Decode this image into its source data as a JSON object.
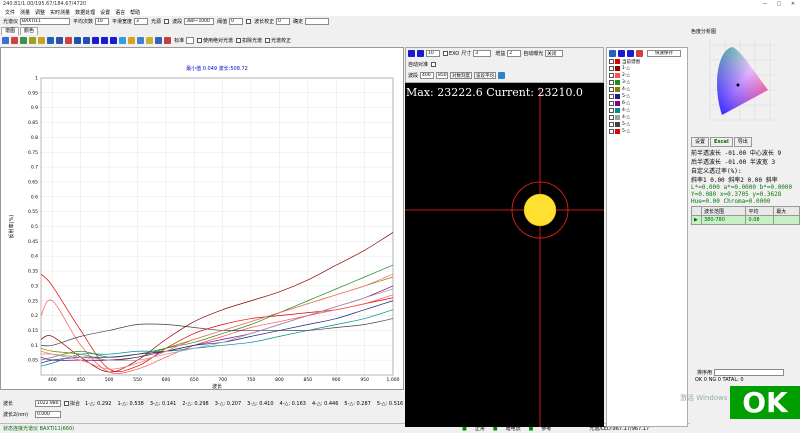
{
  "window": {
    "title": "240.81/1.00/195.67/184.67/4720",
    "controls": [
      "—",
      "□",
      "✕"
    ]
  },
  "menu": [
    "文件",
    "测量",
    "调整",
    "实时测量",
    "数据处理",
    "设置",
    "语言",
    "帮助"
  ],
  "toolbar1": {
    "spectrometer_label": "光谱仪",
    "spectrometer_value": "BAXTI11",
    "avg_label": "平均次数",
    "avg_value": "10",
    "smooth_label": "平滑宽度",
    "smooth_value": "3",
    "source_label": "光源",
    "fit_label": "波段",
    "fit_value": "380~1000",
    "threshold_label": "阈值",
    "threshold_value": "0",
    "wl_corr_label": "波长校正",
    "wl_corr_value": "0",
    "label_last": "确定"
  },
  "tabs_left": [
    "谱图",
    "颜色"
  ],
  "toolbar2": {
    "standard_label": "标准",
    "check1": "使用绝对光谱",
    "check2": "扣除光谱",
    "check3": "光谱校正"
  },
  "chart_data": {
    "type": "line",
    "title": "最小值 0.049 波长:508.72",
    "xlabel": "波长",
    "ylabel": "反射率(%)",
    "xlim": [
      380,
      1000
    ],
    "ylim": [
      0,
      1
    ],
    "x_ticks": [
      400,
      450,
      500,
      550,
      600,
      650,
      700,
      750,
      800,
      850,
      900,
      950,
      "1,000"
    ],
    "y_ticks": [
      "0.05",
      "0.1",
      "0.15",
      "0.2",
      "0.25",
      "0.3",
      "0.35",
      "0.4",
      "0.45",
      "0.5",
      "0.55",
      "0.6",
      "0.65",
      "0.7",
      "0.75",
      "0.8",
      "0.85",
      "0.9",
      "0.95",
      "1"
    ],
    "grid": true,
    "series": [
      {
        "color": "#8b0000",
        "x": [
          380,
          400,
          450,
          500,
          550,
          600,
          650,
          700,
          750,
          800,
          850,
          900,
          950,
          1000
        ],
        "y": [
          0.12,
          0.13,
          0.06,
          0.01,
          0.05,
          0.12,
          0.18,
          0.22,
          0.25,
          0.28,
          0.32,
          0.37,
          0.42,
          0.48
        ]
      },
      {
        "color": "#e00000",
        "x": [
          380,
          400,
          450,
          500,
          550,
          600,
          650,
          700,
          750,
          800,
          850,
          900,
          950,
          1000
        ],
        "y": [
          0.34,
          0.3,
          0.15,
          0.02,
          0.03,
          0.09,
          0.14,
          0.17,
          0.19,
          0.2,
          0.21,
          0.22,
          0.24,
          0.26
        ]
      },
      {
        "color": "#ff5050",
        "x": [
          380,
          400,
          450,
          500,
          550,
          600,
          650,
          700,
          750,
          800,
          850,
          900,
          950,
          1000
        ],
        "y": [
          0.2,
          0.25,
          0.1,
          0.01,
          0.02,
          0.06,
          0.1,
          0.13,
          0.16,
          0.18,
          0.2,
          0.22,
          0.24,
          0.27
        ]
      },
      {
        "color": "#228b22",
        "x": [
          380,
          400,
          450,
          500,
          550,
          600,
          650,
          700,
          750,
          800,
          850,
          900,
          950,
          1000
        ],
        "y": [
          0.05,
          0.06,
          0.08,
          0.06,
          0.07,
          0.09,
          0.11,
          0.14,
          0.17,
          0.21,
          0.25,
          0.29,
          0.33,
          0.37
        ]
      },
      {
        "color": "#808000",
        "x": [
          380,
          400,
          450,
          500,
          550,
          600,
          650,
          700,
          750,
          800,
          850,
          900,
          950,
          1000
        ],
        "y": [
          0.09,
          0.08,
          0.07,
          0.05,
          0.06,
          0.09,
          0.12,
          0.15,
          0.18,
          0.21,
          0.24,
          0.27,
          0.3,
          0.33
        ]
      },
      {
        "color": "#800080",
        "x": [
          380,
          400,
          450,
          500,
          550,
          600,
          650,
          700,
          750,
          800,
          850,
          900,
          950,
          1000
        ],
        "y": [
          0.06,
          0.05,
          0.05,
          0.05,
          0.06,
          0.08,
          0.1,
          0.12,
          0.14,
          0.17,
          0.2,
          0.23,
          0.26,
          0.3
        ]
      },
      {
        "color": "#1c1c8c",
        "x": [
          380,
          400,
          450,
          500,
          550,
          600,
          650,
          700,
          750,
          800,
          850,
          900,
          950,
          1000
        ],
        "y": [
          0.04,
          0.05,
          0.06,
          0.06,
          0.07,
          0.08,
          0.1,
          0.11,
          0.13,
          0.15,
          0.17,
          0.19,
          0.22,
          0.25
        ]
      },
      {
        "color": "#008b8b",
        "x": [
          380,
          400,
          450,
          500,
          550,
          600,
          650,
          700,
          750,
          800,
          850,
          900,
          950,
          1000
        ],
        "y": [
          0.03,
          0.04,
          0.07,
          0.07,
          0.08,
          0.08,
          0.09,
          0.1,
          0.11,
          0.13,
          0.15,
          0.17,
          0.19,
          0.22
        ]
      },
      {
        "color": "#404040",
        "x": [
          380,
          400,
          450,
          500,
          550,
          600,
          650,
          700,
          750,
          800,
          850,
          900,
          950,
          1000
        ],
        "y": [
          0.1,
          0.1,
          0.13,
          0.15,
          0.17,
          0.17,
          0.16,
          0.15,
          0.15,
          0.15,
          0.15,
          0.16,
          0.17,
          0.19
        ]
      },
      {
        "color": "#a0a0a0",
        "x": [
          380,
          400,
          450,
          500,
          550,
          600,
          650,
          700,
          750,
          800,
          850,
          900,
          950,
          1000
        ],
        "y": [
          0.07,
          0.07,
          0.06,
          0.05,
          0.05,
          0.07,
          0.09,
          0.11,
          0.14,
          0.17,
          0.2,
          0.23,
          0.26,
          0.29
        ]
      },
      {
        "color": "#ff7070",
        "x": [
          380,
          400,
          450,
          500,
          550,
          600,
          650,
          700,
          750,
          800,
          850,
          900,
          950,
          1000
        ],
        "y": [
          0.08,
          0.07,
          0.05,
          0.02,
          0.04,
          0.08,
          0.12,
          0.15,
          0.18,
          0.21,
          0.24,
          0.27,
          0.3,
          0.34
        ]
      }
    ]
  },
  "bottom": {
    "wavelength_label": "波长",
    "wavelength_value": "1022.980",
    "wl2_label": "波长2(nm)",
    "wl2_value": "0.000",
    "fit_check": "拟合",
    "readouts": [
      "1-△: 0.292",
      "1-△: 0.538",
      "3-△: 0.141",
      "2-△: 0.298",
      "3-△: 0.207",
      "3-△: 0.410",
      "4-△: 0.163",
      "4-△: 0.446",
      "5-△: 0.287",
      "5-△: 0.516"
    ]
  },
  "status": {
    "left": "状态连接光谱仪 BAXTI11(660)",
    "s1": "正常",
    "s2": "暗电流",
    "s3": "参考",
    "right": "光谱/LED:967.17/967.17"
  },
  "camera": {
    "size_label": "尺寸",
    "size_value": "3",
    "gain_label": "增益",
    "gain_value": "2",
    "auto_label": "自动曝光",
    "auto_value": "关闭",
    "exposure_value": "10",
    "exp_label": "EXO",
    "wave_label": "波段",
    "wave_from": "400",
    "wave_to": "850",
    "mode_value": "对数刻度",
    "avg_value": "波段平均",
    "auto_check": "自动对准",
    "overlay": "Max: 23222.6 Current: 23210.0"
  },
  "legend": {
    "save_button": "快速保存",
    "items": [
      {
        "label": "当前谱图",
        "color": "#e00000"
      },
      {
        "label": "1-△",
        "color": "#8b0000"
      },
      {
        "label": "2-△",
        "color": "#ff5050"
      },
      {
        "label": "3-△",
        "color": "#228b22"
      },
      {
        "label": "4-△",
        "color": "#808000"
      },
      {
        "label": "5-△",
        "color": "#1c1c8c"
      },
      {
        "label": "6-△",
        "color": "#800080"
      },
      {
        "label": "4-△",
        "color": "#008b8b"
      },
      {
        "label": "4-△",
        "color": "#a0a0a0"
      },
      {
        "label": "5-△",
        "color": "#404040"
      },
      {
        "label": "5-△",
        "color": "#e00000"
      }
    ]
  },
  "right": {
    "panel_title": "色度分析图",
    "tab1": "设置",
    "tab2": "Excel",
    "tab3": "导出",
    "lines": [
      "前半透波长  -01.00  中心波长 9",
      "后半透波长  -01.00  半波宽  3",
      "自定义透过率(%):",
      "斜率1 0.00  斜率2 0.00  斜率",
      "L*=0.000 a*=0.0000 b*=0.0000",
      "Y=0.080 x=0.3705 y=0.3628",
      "Hue=0.00 Chroma=0.0000"
    ],
    "table_head": [
      "波长范围",
      "平均",
      "最大"
    ],
    "table_row": [
      "380-780",
      "0.08",
      ""
    ],
    "sort_label": "排序用",
    "footer": "OK 0 NG 0 TATAL: 0",
    "ok_text": "OK",
    "watermark": "激活 Windows"
  }
}
